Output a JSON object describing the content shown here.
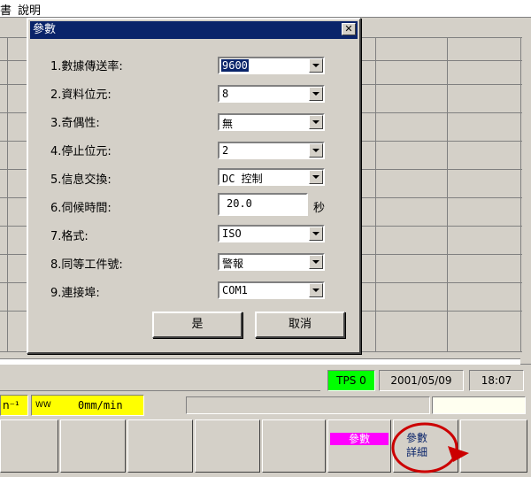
{
  "menubar": {
    "item_left": "書",
    "item_help": "說明"
  },
  "dialog": {
    "title": "參數",
    "close": "✕",
    "params": [
      {
        "label": "1.數據傳送率:",
        "value": "9600",
        "kind": "combo"
      },
      {
        "label": "2.資料位元:",
        "value": "8",
        "kind": "combo"
      },
      {
        "label": "3.奇偶性:",
        "value": "無",
        "kind": "combo"
      },
      {
        "label": "4.停止位元:",
        "value": "2",
        "kind": "combo"
      },
      {
        "label": "5.信息交換:",
        "value": "DC 控制",
        "kind": "combo"
      },
      {
        "label": "6.伺候時間:",
        "value": "20.0",
        "kind": "text",
        "unit": "秒"
      },
      {
        "label": "7.格式:",
        "value": "ISO",
        "kind": "combo"
      },
      {
        "label": "8.同等工件號:",
        "value": "警報",
        "kind": "combo"
      },
      {
        "label": "9.連接埠:",
        "value": "COM1",
        "kind": "combo"
      }
    ],
    "ok_label": "是",
    "cancel_label": "取消"
  },
  "status": {
    "tps": "TPS 0",
    "date": "2001/05/09",
    "time": "18:07"
  },
  "feed": {
    "left_fragment": "n⁻¹",
    "wave_glyph": "WW",
    "rate": "0mm/min"
  },
  "softkeys": {
    "param_label": "參數",
    "detail_label_1": "參數",
    "detail_label_2": "詳細"
  },
  "colors": {
    "title": "#0a246a",
    "tps": "#00ff00",
    "feed": "#ffff00",
    "param_key": "#ff00ff",
    "circle": "#cc0000"
  }
}
